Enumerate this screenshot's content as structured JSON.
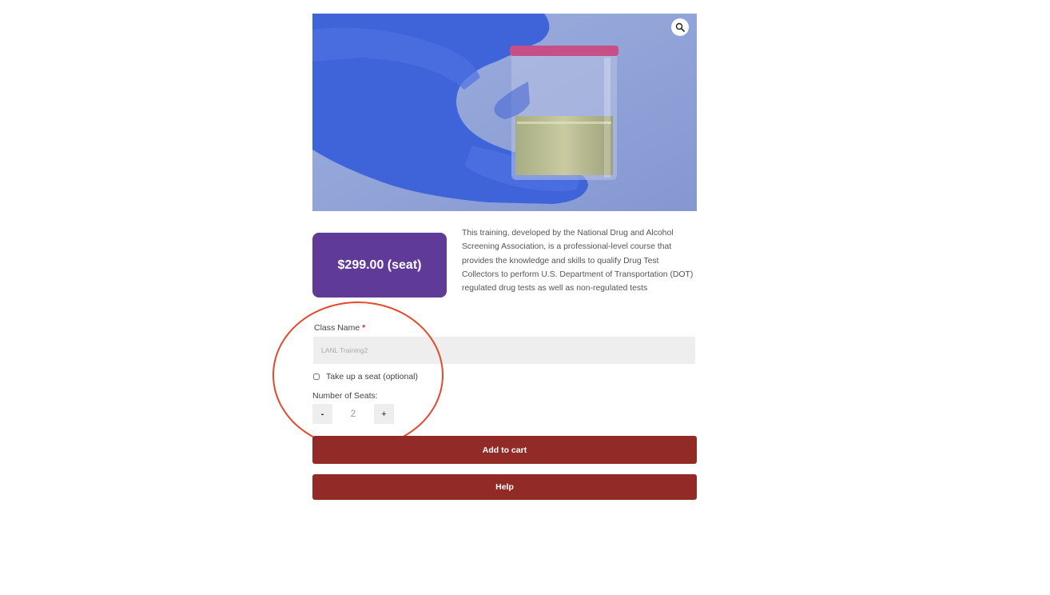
{
  "product": {
    "price_label": "$299.00 (seat)",
    "description": "This training, developed by the National Drug and Alcohol Screening Association, is a professional-level course that provides the knowledge and skills to qualify Drug Test Collectors to perform U.S. Department of Transportation (DOT) regulated drug tests as well as non-regulated tests"
  },
  "form": {
    "class_name_label": "Class Name",
    "required_marker": "*",
    "class_name_value": "LANL Training2",
    "take_seat_label": "Take up a seat (optional)",
    "take_seat_checked": false,
    "seats_label": "Number of Seats:",
    "decrement_label": "-",
    "seats_value": "2",
    "increment_label": "+"
  },
  "actions": {
    "add_to_cart_label": "Add to cart",
    "help_label": "Help"
  },
  "colors": {
    "price_bg": "#5f3b97",
    "button_bg": "#922a27",
    "annotation": "#e14a2d"
  },
  "icons": {
    "zoom": "magnifier-icon"
  }
}
